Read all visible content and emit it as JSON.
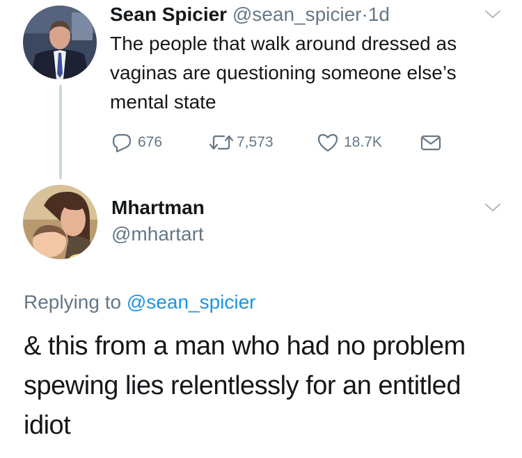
{
  "tweet": {
    "author_name": "Sean Spicier",
    "author_handle": "@sean_spicier",
    "separator": "·",
    "time": "1d",
    "text": "The people that walk around dressed as vaginas are questioning someone else’s mental state",
    "actions": {
      "replies": "676",
      "retweets": "7,573",
      "likes": "18.7K"
    },
    "icons": [
      "reply-icon",
      "retweet-icon",
      "like-icon",
      "dm-icon",
      "chevron-down-icon"
    ]
  },
  "reply": {
    "author_name": "Mhartman",
    "author_handle": "@mhartart",
    "replying_prefix": "Replying to",
    "replying_to": "@sean_spicier",
    "text": "& this from a man who had no problem spewing lies relentlessly for an entitled idiot"
  },
  "colors": {
    "text": "#14171a",
    "secondary": "#657786",
    "link": "#1b95e0",
    "thread_line": "#ccd6dd"
  }
}
